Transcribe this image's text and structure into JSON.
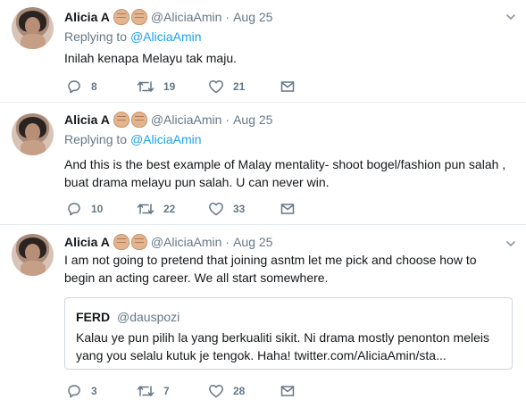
{
  "colors": {
    "link": "#1da1f2",
    "muted": "#657786",
    "text": "#14171a",
    "border": "#e6ecf0"
  },
  "tweets": [
    {
      "name": "Alicia A",
      "handle": "@AliciaAmin",
      "separator": "·",
      "date": "Aug 25",
      "replying_prefix": "Replying to",
      "replying_to": "@AliciaAmin",
      "text": "Inilah kenapa Melayu tak maju.",
      "replies": "8",
      "retweets": "19",
      "likes": "21"
    },
    {
      "name": "Alicia A",
      "handle": "@AliciaAmin",
      "separator": "·",
      "date": "Aug 25",
      "replying_prefix": "Replying to",
      "replying_to": "@AliciaAmin",
      "text_line1": "And this is the best example of Malay mentality- shoot bogel/fashion pun salah ,",
      "text_line2": "buat drama melayu pun salah. U can never win.",
      "replies": "10",
      "retweets": "22",
      "likes": "33"
    },
    {
      "name": "Alicia A",
      "handle": "@AliciaAmin",
      "separator": "·",
      "date": "Aug 25",
      "text_line1": "I am not going to pretend that joining asntm let me pick and choose how to",
      "text_line2": "begin an acting career. We all start somewhere.",
      "quote": {
        "name": "FERD",
        "handle": "@dauspozi",
        "text_line1": "Kalau ye pun pilih la yang berkualiti sikit. Ni drama mostly penonton meleis",
        "text_line2": "yang you selalu kutuk je tengok. Haha! twitter.com/AliciaAmin/sta..."
      },
      "replies": "3",
      "retweets": "7",
      "likes": "28"
    }
  ]
}
